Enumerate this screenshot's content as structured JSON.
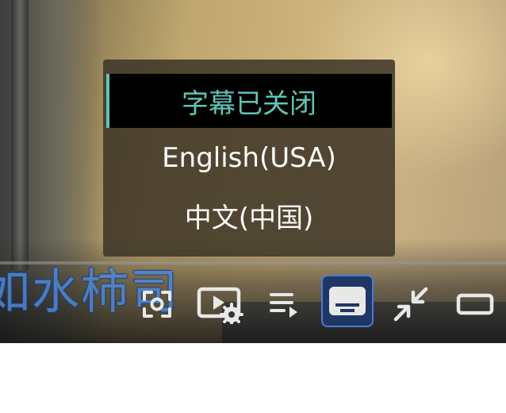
{
  "subtitles_menu": {
    "options": [
      {
        "label": "字幕已关闭",
        "selected": true
      },
      {
        "label": "English(USA)",
        "selected": false
      },
      {
        "label": "中文(中国)",
        "selected": false
      }
    ],
    "accent_color": "#5fc4b5"
  },
  "video": {
    "burned_in_subtitle": "如水柿司"
  },
  "controls": {
    "icons": [
      "screenshot-icon",
      "playback-settings-icon",
      "playlist-icon",
      "subtitles-icon",
      "exit-fullscreen-icon",
      "theater-mode-icon"
    ],
    "active": "subtitles-icon",
    "active_color": "#1f3766"
  }
}
